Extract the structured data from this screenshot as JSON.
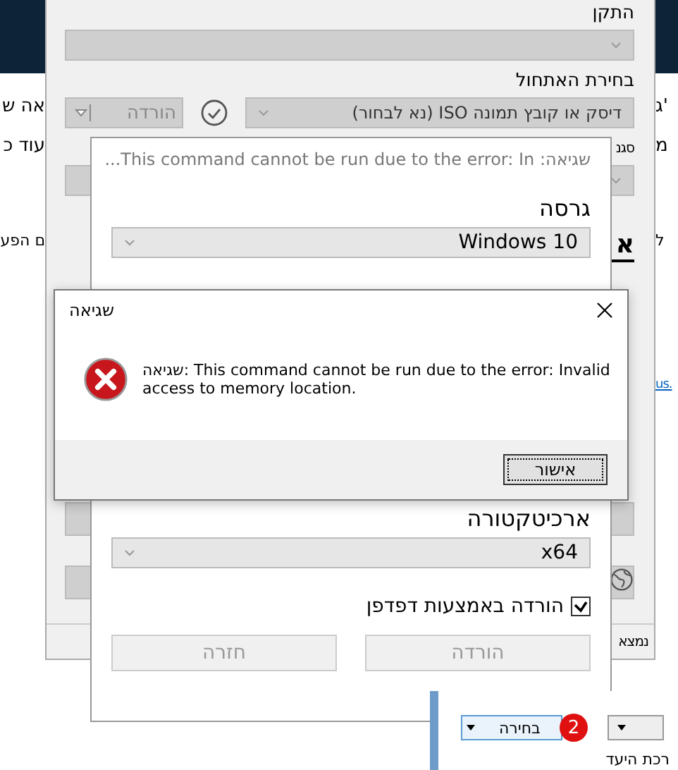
{
  "web_page": {
    "left_fragments": [
      "אה ש",
      "עוד כ",
      "ם הפע"
    ],
    "right_fragments": [
      "ג'",
      "מ",
      "ל"
    ],
    "link_fragment": "us."
  },
  "main_window": {
    "device_label": "התקן",
    "boot_label": "בחירת האתחול",
    "boot_value": "דיסק או קובץ תמונה ISO (נא לבחור)",
    "download_button": "הורדה",
    "scheme_label": "סגנ",
    "section_fragment": "א",
    "status_fragment": "נמצא"
  },
  "download_dialog": {
    "title": "...This command cannot be run due to the error: In :שגיאה",
    "version_label": "גרסה",
    "version_value": "Windows 10",
    "arch_label": "ארכיטקטורה",
    "arch_value": "x64",
    "browser_checkbox": {
      "label": "הורדה באמצעות דפדפן",
      "checked": true
    },
    "buttons": [
      {
        "label": "הורדה",
        "disabled": true
      },
      {
        "label": "חזרה",
        "disabled": true
      }
    ]
  },
  "error_box": {
    "title": "שגיאה",
    "message": "שגיאה: This command cannot be run due to the error: Invalid access to memory location.",
    "ok_button": "אישור"
  },
  "tutorial_image": {
    "select_button": "בחירה",
    "step_badge": "2",
    "caption_fragment": "רכת היעד"
  }
}
